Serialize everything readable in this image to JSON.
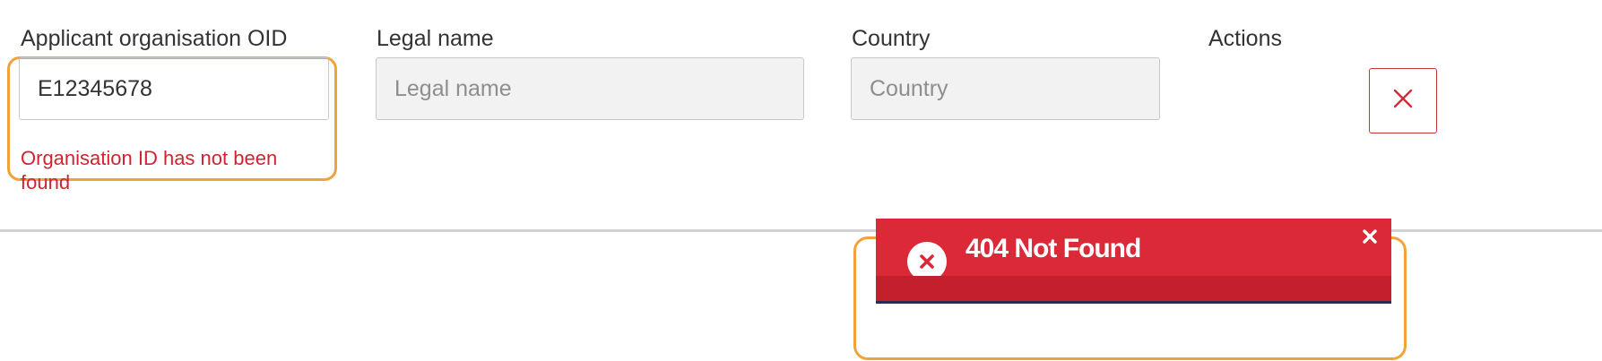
{
  "columns": {
    "oid_label": "Applicant organisation OID",
    "legal_name_label": "Legal name",
    "country_label": "Country",
    "actions_label": "Actions"
  },
  "fields": {
    "oid_value": "E12345678",
    "legal_name_placeholder": "Legal name",
    "country_placeholder": "Country"
  },
  "validation": {
    "oid_error": "Organisation ID has not been found"
  },
  "toast": {
    "title": "404 Not Found",
    "type": "error"
  },
  "icons": {
    "remove_row": "close-icon",
    "toast_status": "error-circle-icon",
    "toast_dismiss": "close-icon"
  },
  "colors": {
    "error": "#cf2330",
    "toast_background": "#dc2937",
    "highlight": "#f0a33a"
  }
}
